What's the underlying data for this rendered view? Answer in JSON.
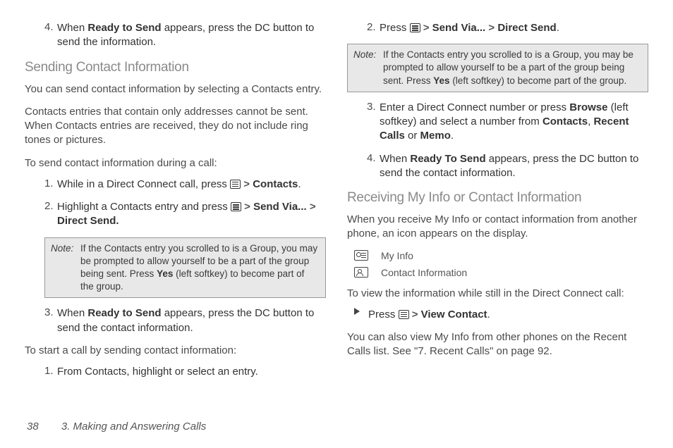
{
  "left": {
    "step4top": {
      "num": "4.",
      "before": "When ",
      "bold": "Ready to Send",
      "after": " appears, press the DC button to send the information."
    },
    "h1": "Sending Contact Information",
    "p1": "You can send contact information by selecting a Contacts entry.",
    "p2": "Contacts entries that contain only addresses cannot be sent. When Contacts entries are received, they do not include ring tones or pictures.",
    "instr1": "To send contact information during a call:",
    "s1": {
      "num": "1.",
      "before": "While in a Direct Connect call, press ",
      "after_gt": true,
      "bold_end": "Contacts",
      "period": "."
    },
    "s2": {
      "num": "2.",
      "before": "Highlight a Contacts entry and press ",
      "after_gt": true,
      "line2a": "Send Via...",
      "gt2": ">",
      "line2b": "Direct Send."
    },
    "note": {
      "label": "Note:",
      "before": "If the Contacts entry you scrolled to is a Group, you may be prompted to allow yourself to be a part of the group being sent. Press ",
      "bold": "Yes",
      "after": " (left softkey) to become part of the group."
    },
    "s3": {
      "num": "3.",
      "before": "When ",
      "bold": "Ready to Send",
      "after": " appears, press the DC button to send the contact information."
    },
    "instr2": "To start a call by sending contact information:",
    "s4": {
      "num": "1.",
      "text": "From Contacts, highlight or select an entry."
    }
  },
  "right": {
    "s2": {
      "num": "2.",
      "before": "Press ",
      "gt1": ">",
      "bold1": "Send Via...",
      "gt2": ">",
      "bold2": "Direct Send",
      "period": "."
    },
    "note": {
      "label": "Note:",
      "before": "If the Contacts entry you scrolled to is a Group, you may be prompted to allow yourself to be a part of the group being sent. Press ",
      "bold": "Yes",
      "after": " (left softkey) to become part of the group."
    },
    "s3": {
      "num": "3.",
      "before": "Enter a Direct Connect number or press ",
      "bold1": "Browse",
      "mid1": " (left softkey) and select a number from ",
      "bold2": "Contacts",
      "comma": ", ",
      "bold3": "Recent Calls",
      "or": " or ",
      "bold4": "Memo",
      "period": "."
    },
    "s4": {
      "num": "4.",
      "before": "When ",
      "bold": "Ready To Send",
      "after": " appears, press the DC button to send the contact information."
    },
    "h2": "Receiving My Info or Contact Information",
    "p3": "When you receive My Info or contact information from another phone, an icon appears on the display.",
    "icon1": "My Info",
    "icon2": "Contact Information",
    "instr3": "To view the information while still in the Direct Connect call:",
    "bullet": {
      "before": "Press ",
      "gt": ">",
      "bold": "View Contact",
      "period": "."
    },
    "p4": "You can also view My Info from other phones on the Recent Calls list. See \"7. Recent Calls\" on page 92."
  },
  "footer": {
    "page": "38",
    "chapter": "3. Making and Answering Calls"
  }
}
